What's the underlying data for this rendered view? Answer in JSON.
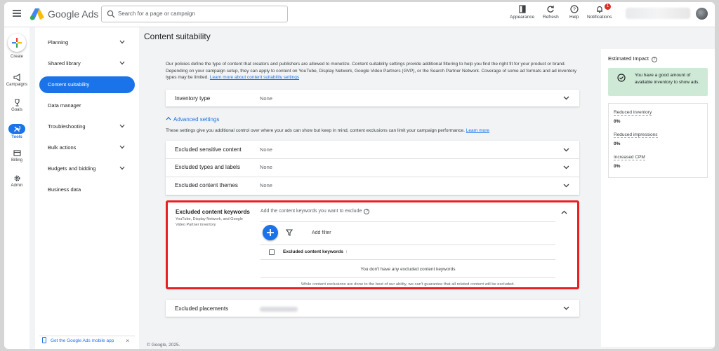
{
  "app": {
    "name": "Google Ads"
  },
  "search": {
    "placeholder": "Search for a page or campaign"
  },
  "toolbar": {
    "appearance_label": "Appearance",
    "refresh_label": "Refresh",
    "help_label": "Help",
    "notifications_label": "Notifications",
    "notification_count": "1"
  },
  "rail": {
    "create": "Create",
    "campaigns": "Campaigns",
    "goals": "Goals",
    "tools": "Tools",
    "billing": "Billing",
    "admin": "Admin"
  },
  "sidenav": {
    "items": [
      {
        "label": "Planning",
        "expandable": true
      },
      {
        "label": "Shared library",
        "expandable": true
      },
      {
        "label": "Content suitability",
        "active": true
      },
      {
        "label": "Data manager"
      },
      {
        "label": "Troubleshooting",
        "expandable": true
      },
      {
        "label": "Bulk actions",
        "expandable": true
      },
      {
        "label": "Budgets and bidding",
        "expandable": true
      },
      {
        "label": "Business data"
      }
    ],
    "mobile_app_label": "Get the Google Ads mobile app"
  },
  "page": {
    "title": "Content suitability",
    "intro": "Our policies define the type of content that creators and publishers are allowed to monetize. Content suitability settings provide additional filtering to help you find the right fit for your product or brand. Depending on your campaign setup, they can apply to content on YouTube, Display Network, Google Video Partners (GVP), or the Search Partner Network. Coverage of some ad formats and ad inventory types may be limited.",
    "intro_link": "Learn more about content suitability settings",
    "inventory_type": {
      "label": "Inventory type",
      "value": "None"
    },
    "advanced_settings_label": "Advanced settings",
    "advanced_desc": "These settings give you additional control over where your ads can show but keep in mind, content exclusions can limit your campaign performance.",
    "advanced_link": "Learn more",
    "excluded_rows": [
      {
        "label": "Excluded sensitive content",
        "value": "None"
      },
      {
        "label": "Excluded types and labels",
        "value": "None"
      },
      {
        "label": "Excluded content themes",
        "value": "None"
      }
    ],
    "keywords": {
      "title": "Excluded content keywords",
      "subtitle": "YouTube, Display Network, and Google Video Partner inventory",
      "prompt": "Add the content keywords you want to exclude",
      "add_filter": "Add filter",
      "column_header": "Excluded content keywords",
      "empty_message": "You don't have any excluded content keywords",
      "disclaimer": "While content exclusions are done to the best of our ability, we can't guarantee that all related content will be excluded."
    },
    "placements": {
      "label": "Excluded placements"
    },
    "footer": "© Google, 2025."
  },
  "impact": {
    "title": "Estimated Impact",
    "banner": "You have a good amount of available inventory to show ads.",
    "metrics": [
      {
        "label": "Reduced inventory",
        "value": "0%"
      },
      {
        "label": "Reduced impressions",
        "value": "0%"
      },
      {
        "label": "Increased CPM",
        "value": "0%"
      }
    ]
  },
  "colors": {
    "accent": "#1a73e8",
    "highlight_border": "#e8201f",
    "success_bg": "#ceead6"
  }
}
